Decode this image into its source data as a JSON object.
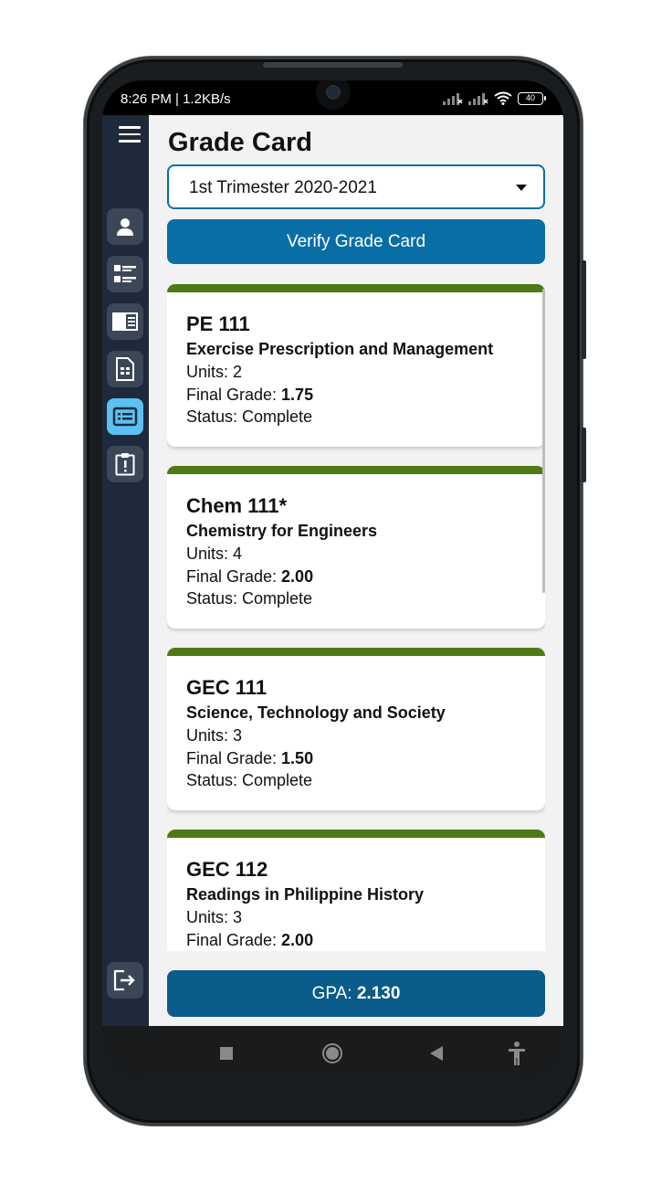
{
  "status_bar": {
    "time": "8:26 PM | 1.2KB/s",
    "battery": "40",
    "icons": [
      "signal-x-icon",
      "signal-x-icon",
      "wifi-icon",
      "battery-icon"
    ]
  },
  "sidebar": {
    "menu_icon": "hamburger-menu-icon",
    "items": [
      {
        "icon": "user-icon",
        "active": false
      },
      {
        "icon": "list-icon",
        "active": false
      },
      {
        "icon": "panel-icon",
        "active": false
      },
      {
        "icon": "document-icon",
        "active": false
      },
      {
        "icon": "grade-card-icon",
        "active": true
      },
      {
        "icon": "clipboard-alert-icon",
        "active": false
      }
    ],
    "logout_icon": "logout-icon"
  },
  "page": {
    "title": "Grade Card",
    "term_select": {
      "value": "1st Trimester 2020-2021"
    },
    "verify_button": "Verify Grade Card"
  },
  "labels": {
    "units": "Units: ",
    "final_grade": "Final Grade: ",
    "status": "Status: "
  },
  "courses": [
    {
      "code": "PE 111",
      "name": "Exercise Prescription and Management",
      "units": "2",
      "final_grade": "1.75",
      "status": "Complete"
    },
    {
      "code": "Chem 111*",
      "name": "Chemistry for Engineers",
      "units": "4",
      "final_grade": "2.00",
      "status": "Complete"
    },
    {
      "code": "GEC 111",
      "name": "Science, Technology and Society",
      "units": "3",
      "final_grade": "1.50",
      "status": "Complete"
    },
    {
      "code": "GEC 112",
      "name": "Readings in Philippine History",
      "units": "3",
      "final_grade": "2.00",
      "status": ""
    }
  ],
  "gpa": {
    "label": "GPA: ",
    "value": "2.130"
  },
  "colors": {
    "sidebar": "#1e2a3b",
    "accent_blue": "#0a6ea6",
    "card_stripe": "#4d7a14",
    "active_nav": "#5bc0f3"
  },
  "system_nav": [
    "square-icon",
    "circle-home-icon",
    "back-triangle-icon",
    "accessibility-icon"
  ]
}
